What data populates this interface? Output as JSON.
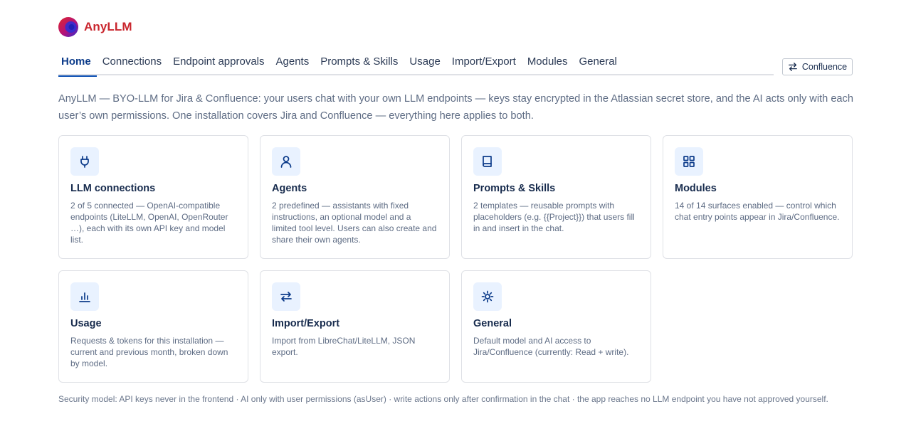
{
  "brand": {
    "name": "AnyLLM"
  },
  "nav": {
    "tabs": [
      {
        "label": "Home",
        "active": true
      },
      {
        "label": "Connections"
      },
      {
        "label": "Endpoint approvals"
      },
      {
        "label": "Agents"
      },
      {
        "label": "Prompts & Skills"
      },
      {
        "label": "Usage"
      },
      {
        "label": "Import/Export"
      },
      {
        "label": "Modules"
      },
      {
        "label": "General"
      }
    ],
    "switch_button": {
      "label": "Confluence",
      "icon": "swap-arrows-icon"
    }
  },
  "intro": "AnyLLM — BYO-LLM for Jira & Confluence: your users chat with your own LLM endpoints — keys stay encrypted in the Atlassian secret store, and the AI acts only with each user’s own permissions. One installation covers Jira and Confluence — everything here applies to both.",
  "cards": [
    {
      "icon": "plug-icon",
      "title": "LLM connections",
      "description": "2 of 5 connected — OpenAI-compatible endpoints (LiteLLM, OpenAI, OpenRouter …), each with its own API key and model list."
    },
    {
      "icon": "user-icon",
      "title": "Agents",
      "description": "2 predefined — assistants with fixed instructions, an optional model and a limited tool level. Users can also create and share their own agents."
    },
    {
      "icon": "book-icon",
      "title": "Prompts & Skills",
      "description": "2 templates — reusable prompts with placeholders (e.g. {{Project}}) that users fill in and insert in the chat."
    },
    {
      "icon": "grid-icon",
      "title": "Modules",
      "description": "14 of 14 surfaces enabled — control which chat entry points appear in Jira/Confluence."
    },
    {
      "icon": "bar-chart-icon",
      "title": "Usage",
      "description": "Requests & tokens for this installation — current and previous month, broken down by model."
    },
    {
      "icon": "swap-arrows-icon",
      "title": "Import/Export",
      "description": "Import from LibreChat/LiteLLM, JSON export."
    },
    {
      "icon": "gear-icon",
      "title": "General",
      "description": "Default model and AI access to Jira/Confluence (currently: Read + write)."
    }
  ],
  "footer": "Security model: API keys never in the frontend · AI only with user permissions (asUser) · write actions only after confirmation in the chat · the app reaches no LLM endpoint you have not approved yourself.",
  "colors": {
    "accent": "#0c4fb3",
    "brand_red": "#c9252d",
    "icon_tile": "#e9f2ff",
    "muted_text": "#5e6c84"
  }
}
